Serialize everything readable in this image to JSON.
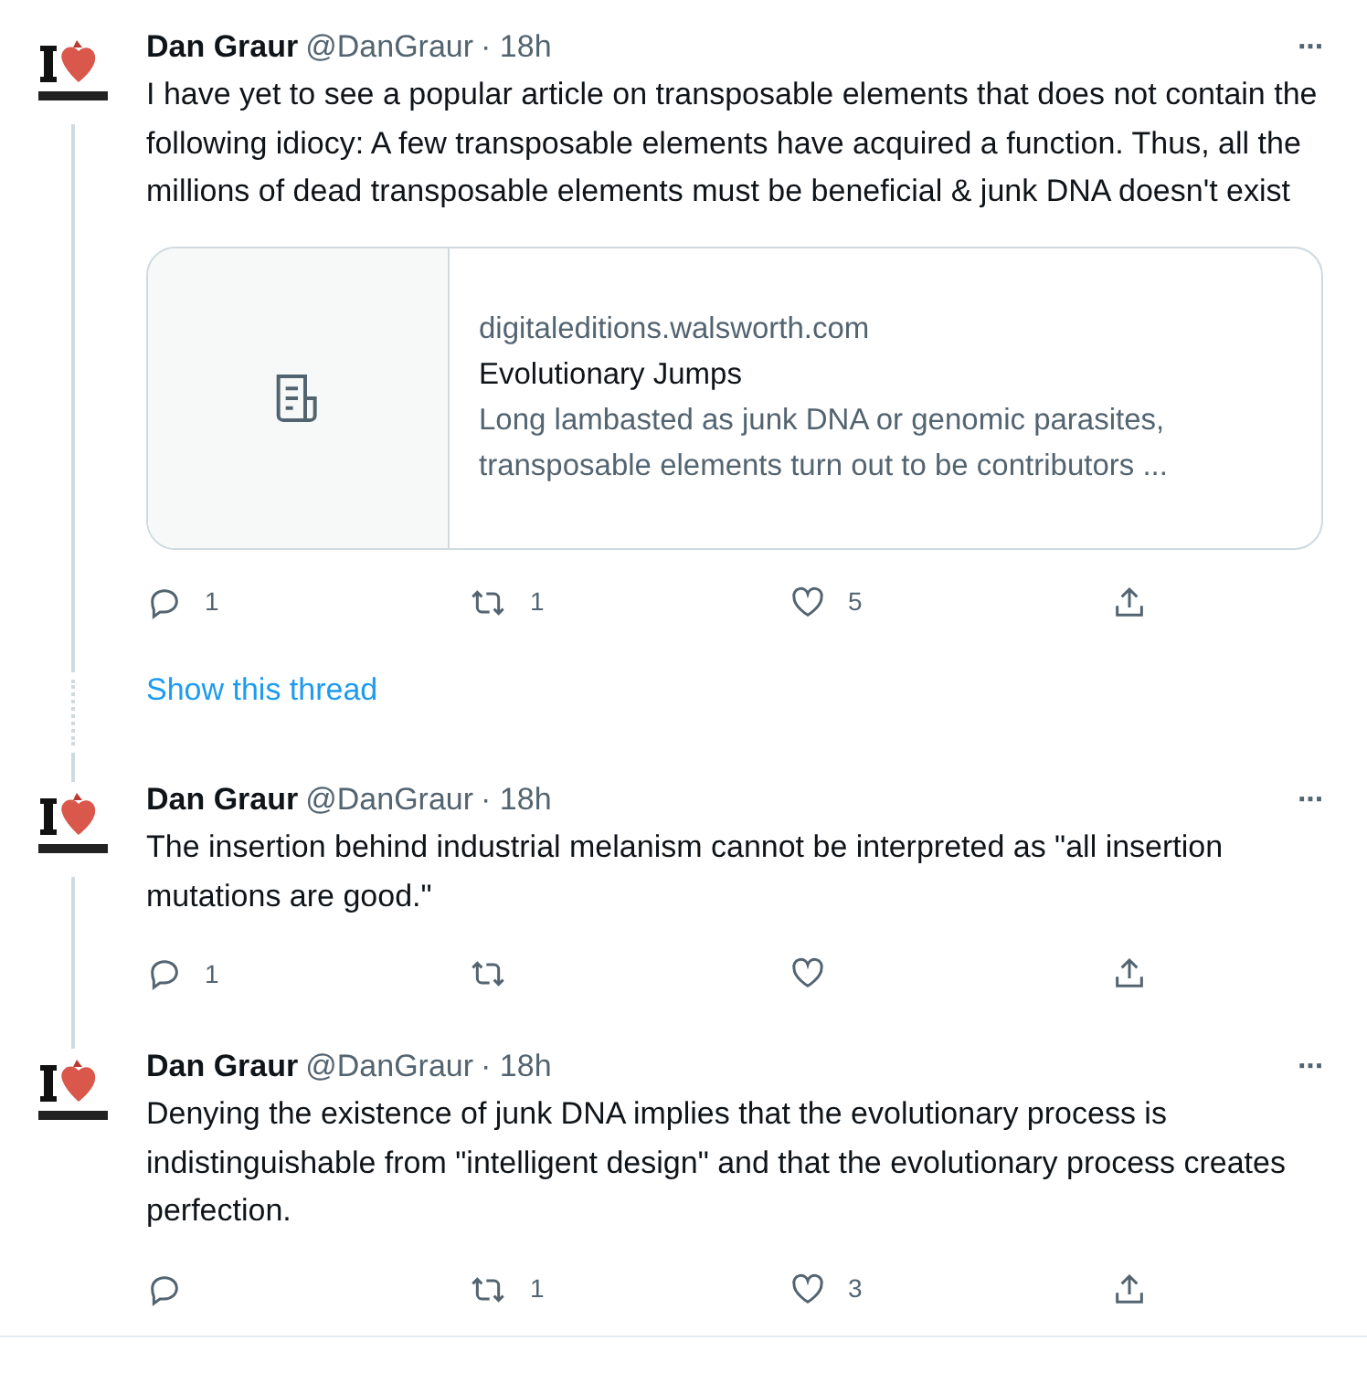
{
  "tweets": [
    {
      "name": "Dan Graur",
      "handle": "@DanGraur",
      "time": "· 18h",
      "more": "···",
      "text": "I have yet to see a popular article on transposable elements that does not contain the following idiocy: A few transposable elements have acquired a function. Thus, all the millions of dead transposable elements must be beneficial & junk DNA doesn't exist",
      "card": {
        "domain": "digitaleditions.walsworth.com",
        "title": "Evolutionary Jumps",
        "description": "Long lambasted as junk DNA or genomic parasites, transposable elements turn out to be contributors ..."
      },
      "replies": "1",
      "retweets": "1",
      "likes": "5",
      "link": "Show this thread"
    },
    {
      "name": "Dan Graur",
      "handle": "@DanGraur",
      "time": "· 18h",
      "more": "···",
      "text": "The insertion behind industrial melanism cannot be interpreted as \"all insertion mutations are good.\"",
      "replies": "1"
    },
    {
      "name": "Dan Graur",
      "handle": "@DanGraur",
      "time": "· 18h",
      "more": "···",
      "text": "Denying the existence of junk DNA implies that the evolutionary process is indistinguishable from \"intelligent design\" and that the evolutionary process creates perfection.",
      "retweets": "1",
      "likes": "3"
    }
  ]
}
